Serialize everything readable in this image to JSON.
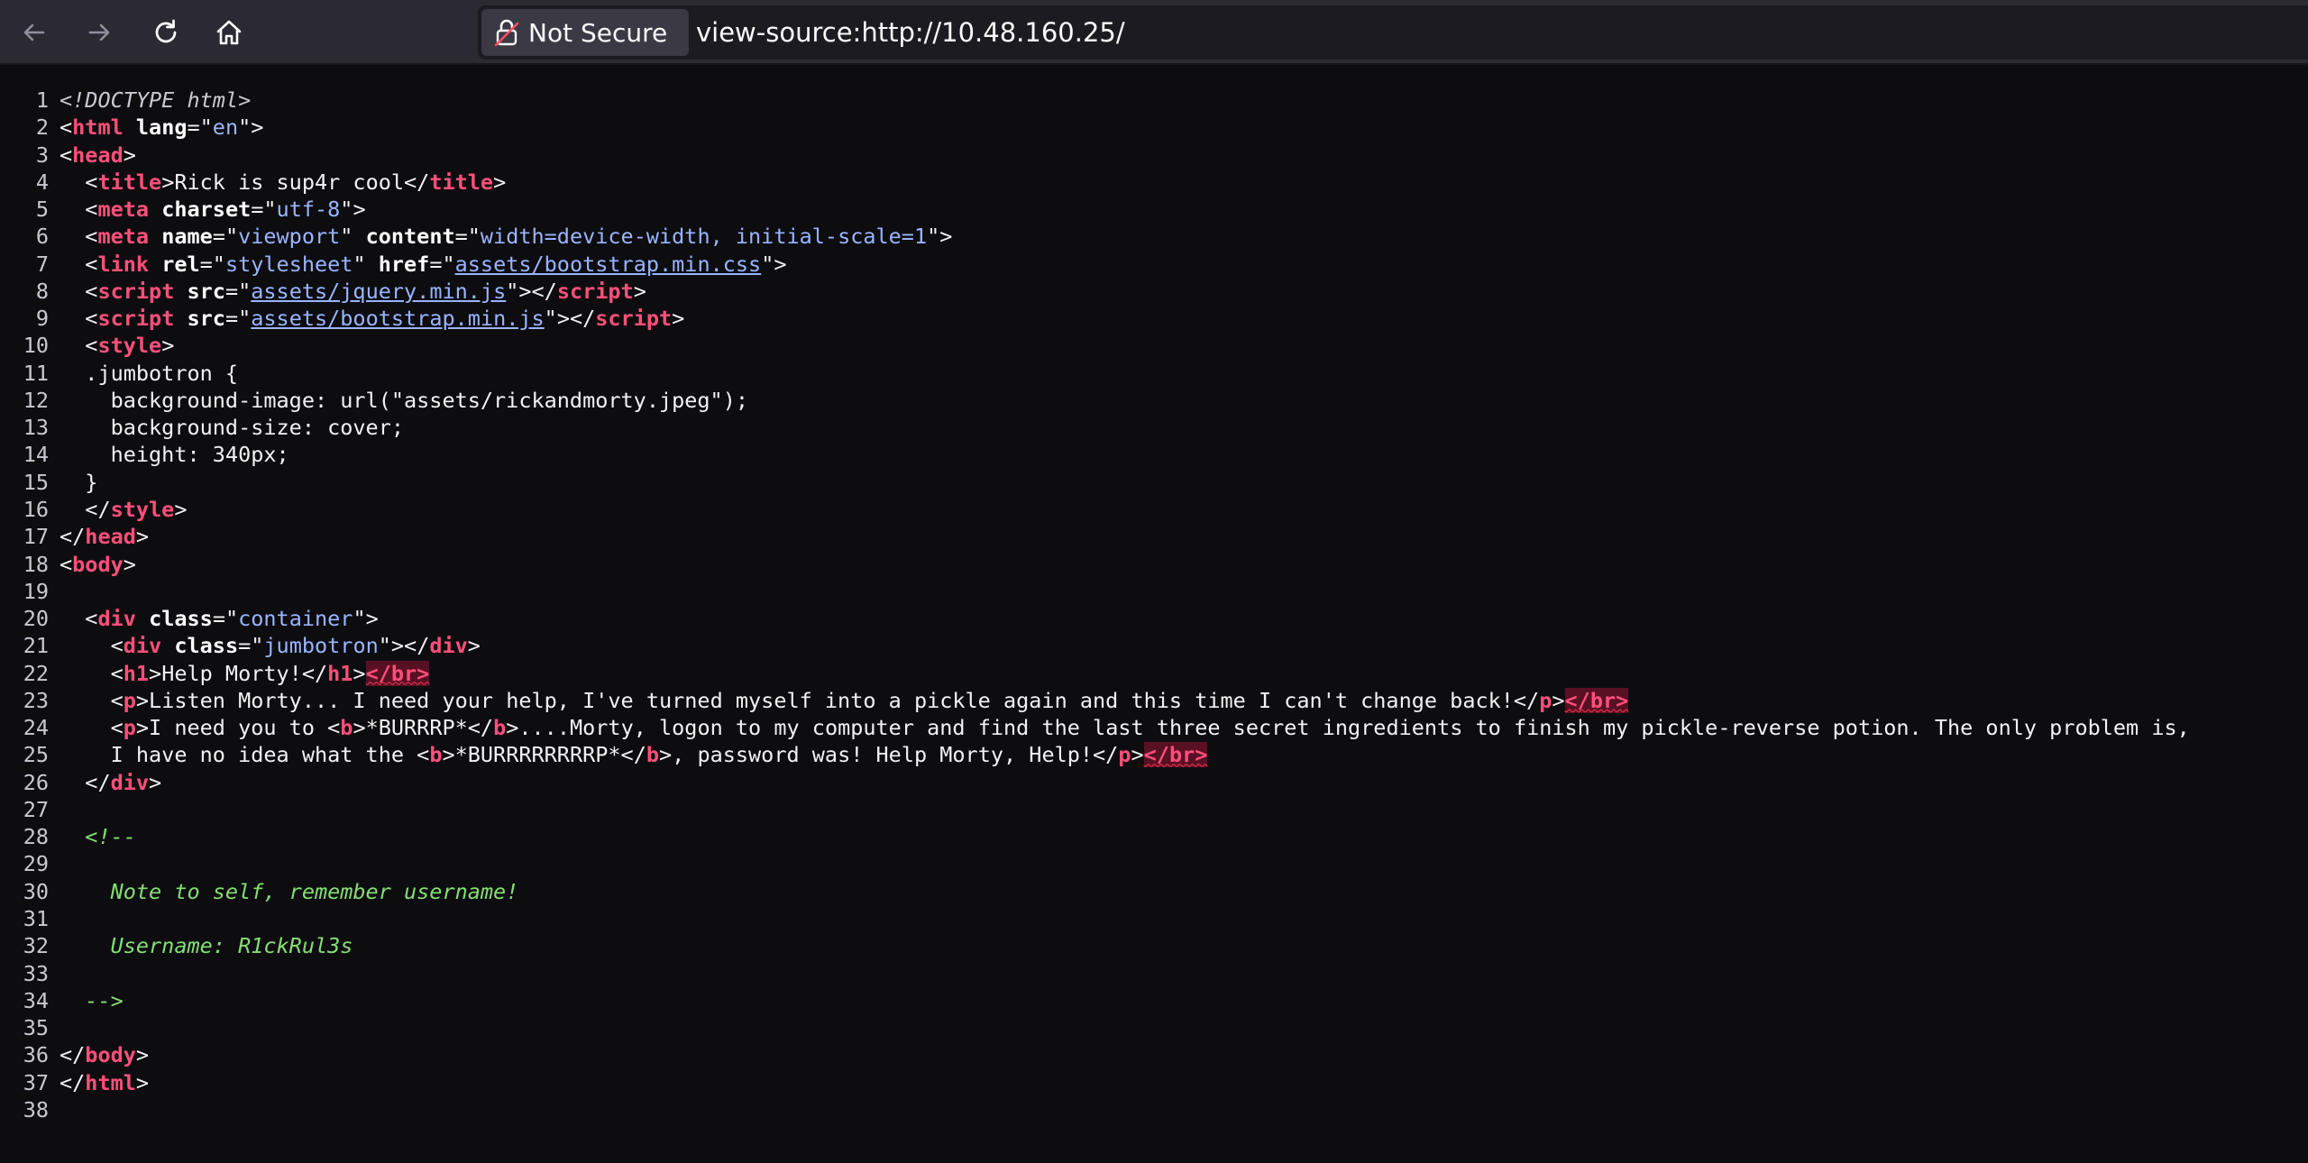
{
  "toolbar": {
    "security_label": "Not Secure",
    "url": "view-source:http://10.48.160.25/"
  },
  "icons": {
    "back": "arrow-left-icon",
    "forward": "arrow-right-icon",
    "reload": "reload-icon",
    "home": "home-icon",
    "security": "broken-lock-icon"
  },
  "colors": {
    "tag": "#ff4f7b",
    "attribute_value": "#9ab4ff",
    "comment": "#86de74",
    "background": "#0d0d10"
  },
  "source_lines": [
    [
      {
        "t": "doctype",
        "v": "<!DOCTYPE html>"
      }
    ],
    [
      {
        "t": "punct",
        "v": "<"
      },
      {
        "t": "tag",
        "v": "html"
      },
      {
        "t": "punct",
        "v": " "
      },
      {
        "t": "attr",
        "v": "lang"
      },
      {
        "t": "punct",
        "v": "=\""
      },
      {
        "t": "val",
        "v": "en"
      },
      {
        "t": "punct",
        "v": "\">"
      }
    ],
    [
      {
        "t": "punct",
        "v": "<"
      },
      {
        "t": "tag",
        "v": "head"
      },
      {
        "t": "punct",
        "v": ">"
      }
    ],
    [
      {
        "t": "punct",
        "v": "  <"
      },
      {
        "t": "tag",
        "v": "title"
      },
      {
        "t": "punct",
        "v": ">Rick is sup4r cool</"
      },
      {
        "t": "tag",
        "v": "title"
      },
      {
        "t": "punct",
        "v": ">"
      }
    ],
    [
      {
        "t": "punct",
        "v": "  <"
      },
      {
        "t": "tag",
        "v": "meta"
      },
      {
        "t": "punct",
        "v": " "
      },
      {
        "t": "attr",
        "v": "charset"
      },
      {
        "t": "punct",
        "v": "=\""
      },
      {
        "t": "val",
        "v": "utf-8"
      },
      {
        "t": "punct",
        "v": "\">"
      }
    ],
    [
      {
        "t": "punct",
        "v": "  <"
      },
      {
        "t": "tag",
        "v": "meta"
      },
      {
        "t": "punct",
        "v": " "
      },
      {
        "t": "attr",
        "v": "name"
      },
      {
        "t": "punct",
        "v": "=\""
      },
      {
        "t": "val",
        "v": "viewport"
      },
      {
        "t": "punct",
        "v": "\" "
      },
      {
        "t": "attr",
        "v": "content"
      },
      {
        "t": "punct",
        "v": "=\""
      },
      {
        "t": "val",
        "v": "width=device-width, initial-scale=1"
      },
      {
        "t": "punct",
        "v": "\">"
      }
    ],
    [
      {
        "t": "punct",
        "v": "  <"
      },
      {
        "t": "tag",
        "v": "link"
      },
      {
        "t": "punct",
        "v": " "
      },
      {
        "t": "attr",
        "v": "rel"
      },
      {
        "t": "punct",
        "v": "=\""
      },
      {
        "t": "val",
        "v": "stylesheet"
      },
      {
        "t": "punct",
        "v": "\" "
      },
      {
        "t": "attr",
        "v": "href"
      },
      {
        "t": "punct",
        "v": "=\""
      },
      {
        "t": "link",
        "v": "assets/bootstrap.min.css"
      },
      {
        "t": "punct",
        "v": "\">"
      }
    ],
    [
      {
        "t": "punct",
        "v": "  <"
      },
      {
        "t": "tag",
        "v": "script"
      },
      {
        "t": "punct",
        "v": " "
      },
      {
        "t": "attr",
        "v": "src"
      },
      {
        "t": "punct",
        "v": "=\""
      },
      {
        "t": "link",
        "v": "assets/jquery.min.js"
      },
      {
        "t": "punct",
        "v": "\"></"
      },
      {
        "t": "tag",
        "v": "script"
      },
      {
        "t": "punct",
        "v": ">"
      }
    ],
    [
      {
        "t": "punct",
        "v": "  <"
      },
      {
        "t": "tag",
        "v": "script"
      },
      {
        "t": "punct",
        "v": " "
      },
      {
        "t": "attr",
        "v": "src"
      },
      {
        "t": "punct",
        "v": "=\""
      },
      {
        "t": "link",
        "v": "assets/bootstrap.min.js"
      },
      {
        "t": "punct",
        "v": "\"></"
      },
      {
        "t": "tag",
        "v": "script"
      },
      {
        "t": "punct",
        "v": ">"
      }
    ],
    [
      {
        "t": "punct",
        "v": "  <"
      },
      {
        "t": "tag",
        "v": "style"
      },
      {
        "t": "punct",
        "v": ">"
      }
    ],
    [
      {
        "t": "punct",
        "v": "  .jumbotron {"
      }
    ],
    [
      {
        "t": "punct",
        "v": "    background-image: url(\"assets/rickandmorty.jpeg\");"
      }
    ],
    [
      {
        "t": "punct",
        "v": "    background-size: cover;"
      }
    ],
    [
      {
        "t": "punct",
        "v": "    height: 340px;"
      }
    ],
    [
      {
        "t": "punct",
        "v": "  }"
      }
    ],
    [
      {
        "t": "punct",
        "v": "  </"
      },
      {
        "t": "tag",
        "v": "style"
      },
      {
        "t": "punct",
        "v": ">"
      }
    ],
    [
      {
        "t": "punct",
        "v": "</"
      },
      {
        "t": "tag",
        "v": "head"
      },
      {
        "t": "punct",
        "v": ">"
      }
    ],
    [
      {
        "t": "punct",
        "v": "<"
      },
      {
        "t": "tag",
        "v": "body"
      },
      {
        "t": "punct",
        "v": ">"
      }
    ],
    [],
    [
      {
        "t": "punct",
        "v": "  <"
      },
      {
        "t": "tag",
        "v": "div"
      },
      {
        "t": "punct",
        "v": " "
      },
      {
        "t": "attr",
        "v": "class"
      },
      {
        "t": "punct",
        "v": "=\""
      },
      {
        "t": "val",
        "v": "container"
      },
      {
        "t": "punct",
        "v": "\">"
      }
    ],
    [
      {
        "t": "punct",
        "v": "    <"
      },
      {
        "t": "tag",
        "v": "div"
      },
      {
        "t": "punct",
        "v": " "
      },
      {
        "t": "attr",
        "v": "class"
      },
      {
        "t": "punct",
        "v": "=\""
      },
      {
        "t": "val",
        "v": "jumbotron"
      },
      {
        "t": "punct",
        "v": "\"></"
      },
      {
        "t": "tag",
        "v": "div"
      },
      {
        "t": "punct",
        "v": ">"
      }
    ],
    [
      {
        "t": "punct",
        "v": "    <"
      },
      {
        "t": "tag",
        "v": "h1"
      },
      {
        "t": "punct",
        "v": ">Help Morty!</"
      },
      {
        "t": "tag",
        "v": "h1"
      },
      {
        "t": "punct",
        "v": ">"
      },
      {
        "t": "tag-err",
        "v": "</br>"
      }
    ],
    [
      {
        "t": "punct",
        "v": "    <"
      },
      {
        "t": "tag",
        "v": "p"
      },
      {
        "t": "punct",
        "v": ">Listen Morty... I need your help, I've turned myself into a pickle again and this time I can't change back!</"
      },
      {
        "t": "tag",
        "v": "p"
      },
      {
        "t": "punct",
        "v": ">"
      },
      {
        "t": "tag-err",
        "v": "</br>"
      }
    ],
    [
      {
        "t": "punct",
        "v": "    <"
      },
      {
        "t": "tag",
        "v": "p"
      },
      {
        "t": "punct",
        "v": ">I need you to <"
      },
      {
        "t": "tag",
        "v": "b"
      },
      {
        "t": "punct",
        "v": ">*BURRRP*</"
      },
      {
        "t": "tag",
        "v": "b"
      },
      {
        "t": "punct",
        "v": ">....Morty, logon to my computer and find the last three secret ingredients to finish my pickle-reverse potion. The only problem is,"
      }
    ],
    [
      {
        "t": "punct",
        "v": "    I have no idea what the <"
      },
      {
        "t": "tag",
        "v": "b"
      },
      {
        "t": "punct",
        "v": ">*BURRRRRRRRP*</"
      },
      {
        "t": "tag",
        "v": "b"
      },
      {
        "t": "punct",
        "v": ">, password was! Help Morty, Help!</"
      },
      {
        "t": "tag",
        "v": "p"
      },
      {
        "t": "punct",
        "v": ">"
      },
      {
        "t": "tag-err",
        "v": "</br>"
      }
    ],
    [
      {
        "t": "punct",
        "v": "  </"
      },
      {
        "t": "tag",
        "v": "div"
      },
      {
        "t": "punct",
        "v": ">"
      }
    ],
    [],
    [
      {
        "t": "comment",
        "v": "  <!--"
      }
    ],
    [],
    [
      {
        "t": "comment",
        "v": "    Note to self, remember username!"
      }
    ],
    [],
    [
      {
        "t": "comment",
        "v": "    Username: R1ckRul3s"
      }
    ],
    [],
    [
      {
        "t": "comment",
        "v": "  -->"
      }
    ],
    [],
    [
      {
        "t": "punct",
        "v": "</"
      },
      {
        "t": "tag",
        "v": "body"
      },
      {
        "t": "punct",
        "v": ">"
      }
    ],
    [
      {
        "t": "punct",
        "v": "</"
      },
      {
        "t": "tag",
        "v": "html"
      },
      {
        "t": "punct",
        "v": ">"
      }
    ],
    []
  ]
}
